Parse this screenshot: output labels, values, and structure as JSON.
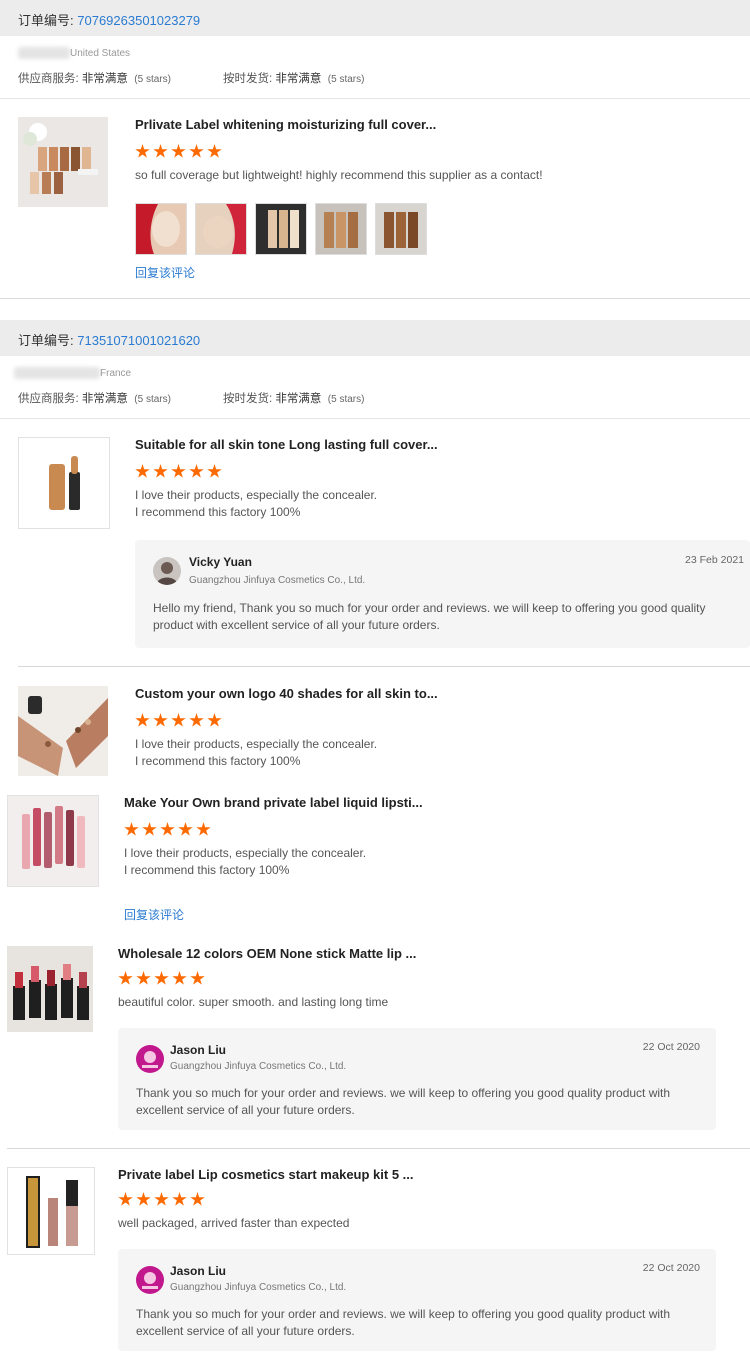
{
  "orders": [
    {
      "label": "订单编号:",
      "number": "70769263501023279",
      "country": "United States",
      "supplier_service_label": "供应商服务:",
      "supplier_service_value": "非常满意",
      "supplier_service_stars": "(5 stars)",
      "ontime_label": "按时发货:",
      "ontime_value": "非常满意",
      "ontime_stars": "(5 stars)",
      "products": [
        {
          "title": "Prlivate Label whitening moisturizing full cover...",
          "comment": "so full coverage but lightweight! highly recommend this supplier as a contact!",
          "reply_link": "回复该评论"
        }
      ]
    },
    {
      "label": "订单编号:",
      "number": "71351071001021620",
      "country": "France",
      "supplier_service_label": "供应商服务:",
      "supplier_service_value": "非常满意",
      "supplier_service_stars": "(5 stars)",
      "ontime_label": "按时发货:",
      "ontime_value": "非常满意",
      "ontime_stars": "(5 stars)",
      "products": [
        {
          "title": "Suitable for all skin tone Long lasting full cover...",
          "comment_line1": "I love their products, especially the concealer.",
          "comment_line2": "I recommend this factory 100%",
          "reply": {
            "name": "Vicky Yuan",
            "company": "Guangzhou Jinfuya Cosmetics Co., Ltd.",
            "date": "23 Feb 2021",
            "text": "Hello my friend, Thank you so much for your order and reviews. we will keep to offering you good quality product with excellent service of all your future orders."
          }
        },
        {
          "title": "Custom your own logo 40 shades for all skin to...",
          "comment_line1": "I love their products, especially the concealer.",
          "comment_line2": "I recommend this factory 100%"
        }
      ]
    }
  ],
  "extra_products": [
    {
      "title": "Make Your Own brand private label liquid lipsti...",
      "comment_line1": "I love their products, especially the concealer.",
      "comment_line2": "I recommend this factory 100%",
      "reply_link": "回复该评论"
    },
    {
      "title": "Wholesale 12 colors OEM None stick Matte lip ...",
      "comment": "beautiful color. super smooth. and lasting long time",
      "reply": {
        "name": "Jason Liu",
        "company": "Guangzhou Jinfuya Cosmetics Co., Ltd.",
        "date": "22 Oct 2020",
        "text": "Thank you so much for your order and reviews. we will keep to offering you good quality product with excellent service of all your future orders."
      }
    },
    {
      "title": "Private label Lip cosmetics start makeup kit 5 ...",
      "comment": "well packaged, arrived faster than expected",
      "reply": {
        "name": "Jason Liu",
        "company": "Guangzhou Jinfuya Cosmetics Co., Ltd.",
        "date": "22 Oct 2020",
        "text": "Thank you so much for your order and reviews. we will keep to offering you good quality product with excellent service of all your future orders."
      }
    }
  ],
  "rating": 5,
  "colors": {
    "star": "#ff6a00",
    "link": "#2a7bd1",
    "order_bar": "#ececec",
    "reply_bg": "#f5f5f5"
  },
  "icons": [
    "star-icon",
    "avatar-icon"
  ]
}
